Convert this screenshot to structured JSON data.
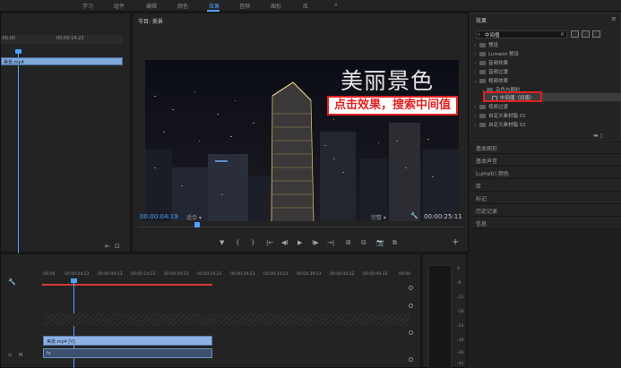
{
  "workspace_tabs": [
    {
      "label": "学习",
      "active": false
    },
    {
      "label": "组件",
      "active": false
    },
    {
      "label": "编辑",
      "active": false
    },
    {
      "label": "颜色",
      "active": false
    },
    {
      "label": "效果",
      "active": true
    },
    {
      "label": "音频",
      "active": false
    },
    {
      "label": "图形",
      "active": false
    },
    {
      "label": "库",
      "active": false
    }
  ],
  "workspace_more": "»",
  "source": {
    "time_start": ":00:00",
    "time_mark": "00:00:14:23",
    "clip_label": "美景.mp4"
  },
  "program": {
    "title": "节目: 美景",
    "video_title": "美丽景色",
    "callout": "点击效果，搜索中间值",
    "timecode_current": "00:00:04:19",
    "fit": "适合",
    "quality": "完整",
    "timecode_duration": "00:00:25:11",
    "transport": [
      "▼",
      "{",
      "}",
      "|←",
      "◀I",
      "▶",
      "I▶",
      "→|",
      "⊞",
      "⊟",
      "📷",
      "⧉"
    ],
    "add": "+"
  },
  "effects": {
    "title": "效果",
    "menu": "≡",
    "search_value": "中间值",
    "search_clear": "×",
    "tree": [
      {
        "label": "预设",
        "indent": 0
      },
      {
        "label": "Lumetri 预设",
        "indent": 0
      },
      {
        "label": "音频效果",
        "indent": 0
      },
      {
        "label": "音频过渡",
        "indent": 0
      },
      {
        "label": "视频效果",
        "indent": 0
      },
      {
        "label": "杂色与颗粒",
        "indent": 1
      },
      {
        "label": "中间值（旧版）",
        "indent": 2
      },
      {
        "label": "视频过渡",
        "indent": 0
      },
      {
        "label": "自定义素材箱 01",
        "indent": 0
      },
      {
        "label": "自定义素材箱 02",
        "indent": 0
      }
    ],
    "bottom_icons": "▬  ▯"
  },
  "stack_panels": [
    "基本图形",
    "基本声音",
    "Lumetri 颜色",
    "库",
    "标记",
    "历史记录",
    "信息"
  ],
  "timeline": {
    "ruler_ticks": [
      ":00:00",
      "00:00:04:23",
      "00:00:09:23",
      "00:00:14:23",
      "00:00:19:23",
      "00:00:24:23",
      "00:00:29:23",
      "00:00:34:23",
      "00:00:39:23",
      "00:00:44:22",
      "00:00:49:22",
      "00:00"
    ],
    "video_clip": "美景.mp4 [V]",
    "audio_clip": "fx"
  },
  "meter": {
    "labels": [
      "0",
      "-6",
      "-12",
      "-18",
      "-24",
      "-30",
      "-36",
      "-42"
    ]
  },
  "colors": {
    "accent": "#4ea1ff",
    "highlight_red": "#e02020",
    "workarea_red": "#d23a3a",
    "clip_blue": "#8fb2e4"
  }
}
